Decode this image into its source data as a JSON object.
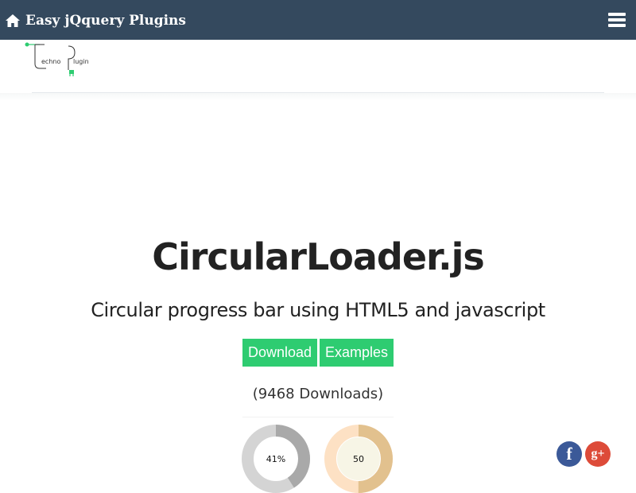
{
  "header": {
    "home_icon": "home-icon",
    "site_title": "Easy jQquery Plugins",
    "menu_icon": "hamburger-menu-icon",
    "bg_color": "#34495e"
  },
  "logo": {
    "word1": "echno",
    "word2": "lugin",
    "accent_color": "#2ecc71"
  },
  "main": {
    "title": "CircularLoader.js",
    "subtitle": "Circular progress bar using HTML5 and javascript",
    "buttons": {
      "download": "Download",
      "examples": "Examples",
      "color": "#2ecc71"
    },
    "downloads_text": "(9468 Downloads)"
  },
  "demo": {
    "loaders": [
      {
        "label": "41%",
        "progress": 0.41,
        "track_color": "#d4d4d4",
        "fill_color": "#a9a9a9",
        "center_color": "#ffffff"
      },
      {
        "label": "50",
        "progress": 0.5,
        "track_color": "#fde1c4",
        "fill_color": "#e2c18e",
        "center_color": "#f7f5e6"
      }
    ]
  },
  "social": {
    "facebook": {
      "glyph": "f",
      "icon": "facebook-icon",
      "color": "#3b5998"
    },
    "googleplus": {
      "glyph": "g+",
      "icon": "google-plus-icon",
      "color": "#dd4b39"
    }
  }
}
